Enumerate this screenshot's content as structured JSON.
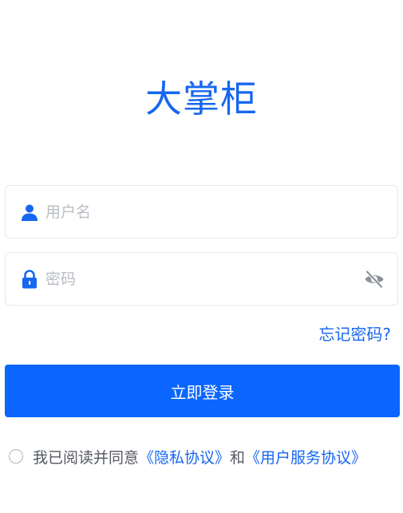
{
  "app": {
    "title": "大掌柜"
  },
  "form": {
    "username": {
      "icon": "user-icon",
      "placeholder": "用户名",
      "value": ""
    },
    "password": {
      "icon": "lock-icon",
      "placeholder": "密码",
      "value": "",
      "toggle_icon": "eye-off-icon"
    },
    "forgot_label": "忘记密码?",
    "login_label": "立即登录"
  },
  "agreement": {
    "checked": false,
    "prefix": "我已阅读并同意",
    "privacy_link": "《隐私协议》",
    "connector": "和",
    "service_link": "《用户服务协议》"
  },
  "colors": {
    "brand": "#1767f0",
    "button": "#0a66ff",
    "placeholder": "#b9bdc4",
    "border": "#e6e8eb"
  }
}
